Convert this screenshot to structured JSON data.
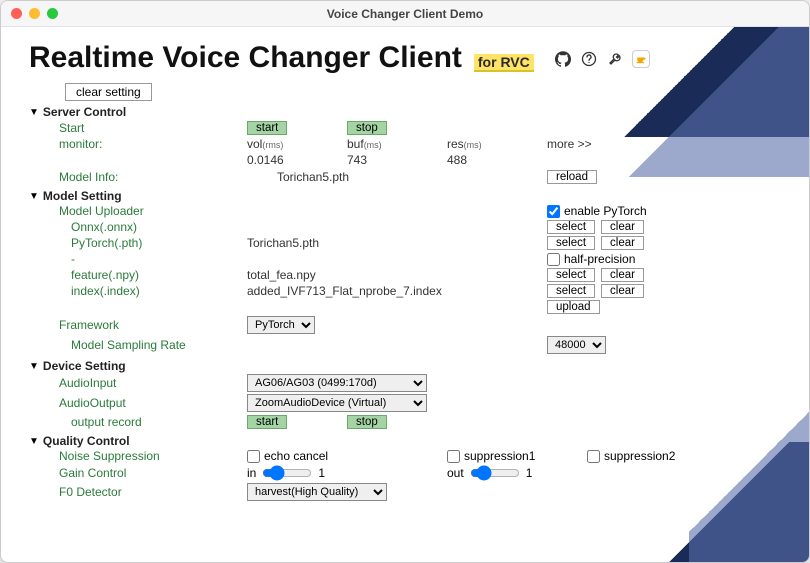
{
  "window": {
    "title": "Voice Changer Client Demo"
  },
  "header": {
    "app_title": "Realtime Voice Changer Client",
    "for_tag": "for RVC"
  },
  "toolbar": {
    "clear_setting": "clear setting"
  },
  "sections": {
    "server_control": {
      "title": "Server Control",
      "start_label": "Start",
      "start_btn": "start",
      "stop_btn": "stop",
      "monitor_label": "monitor:",
      "vol_label": "vol",
      "vol_unit": "(rms)",
      "vol_value": "0.0146",
      "buf_label": "buf",
      "buf_unit": "(ms)",
      "buf_value": "743",
      "res_label": "res",
      "res_unit": "(ms)",
      "res_value": "488",
      "more_label": "more >>",
      "model_info_label": "Model Info:",
      "model_info_value": "Torichan5.pth",
      "reload_btn": "reload"
    },
    "model_setting": {
      "title": "Model Setting",
      "uploader_label": "Model Uploader",
      "enable_pytorch_label": "enable PyTorch",
      "onnx_label": "Onnx(.onnx)",
      "pytorch_label": "PyTorch(.pth)",
      "pytorch_value": "Torichan5.pth",
      "dash_label": "-",
      "half_precision_label": "half-precision",
      "feature_label": "feature(.npy)",
      "feature_value": "total_fea.npy",
      "index_label": "index(.index)",
      "index_value": "added_IVF713_Flat_nprobe_7.index",
      "select_btn": "select",
      "clear_btn": "clear",
      "upload_btn": "upload",
      "framework_label": "Framework",
      "framework_value": "PyTorch",
      "sampling_rate_label": "Model Sampling Rate",
      "sampling_rate_value": "48000"
    },
    "device_setting": {
      "title": "Device Setting",
      "audio_input_label": "AudioInput",
      "audio_input_value": "AG06/AG03 (0499:170d)",
      "audio_output_label": "AudioOutput",
      "audio_output_value": "ZoomAudioDevice (Virtual)",
      "output_record_label": "output record",
      "start_btn": "start",
      "stop_btn": "stop"
    },
    "quality_control": {
      "title": "Quality Control",
      "noise_sup_label": "Noise Suppression",
      "echo_cancel_label": "echo cancel",
      "suppression1_label": "suppression1",
      "suppression2_label": "suppression2",
      "gain_label": "Gain Control",
      "gain_in_label": "in",
      "gain_in_value": "1",
      "gain_out_label": "out",
      "gain_out_value": "1",
      "f0_label": "F0 Detector",
      "f0_value": "harvest(High Quality)"
    }
  }
}
